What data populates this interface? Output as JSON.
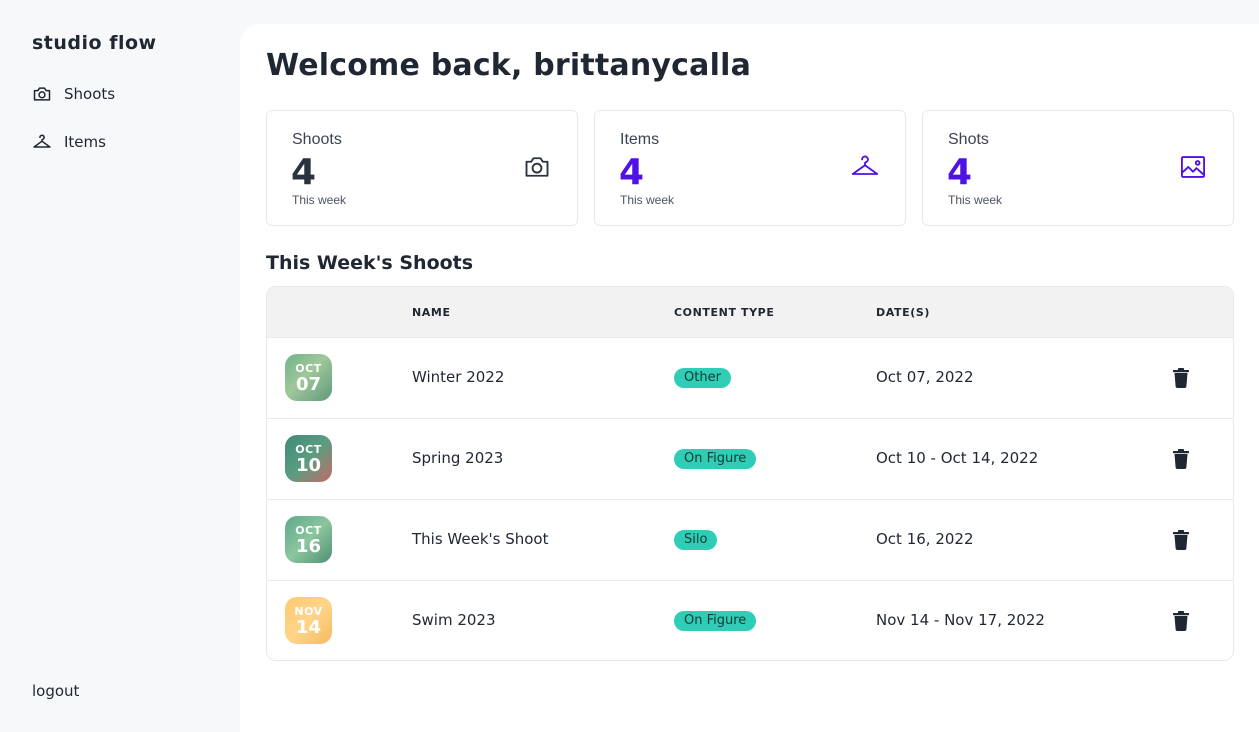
{
  "sidebar": {
    "brand": "studio flow",
    "nav": [
      {
        "label": "Shoots",
        "icon": "camera-icon"
      },
      {
        "label": "Items",
        "icon": "hanger-icon"
      }
    ],
    "logout_label": "logout"
  },
  "main": {
    "welcome": "Welcome back, brittanycalla",
    "stats": [
      {
        "label": "Shoots",
        "value": "4",
        "sub": "This week",
        "icon": "camera-icon",
        "color": "#2a323f"
      },
      {
        "label": "Items",
        "value": "4",
        "sub": "This week",
        "icon": "hanger-icon",
        "color": "#4e12e6"
      },
      {
        "label": "Shots",
        "value": "4",
        "sub": "This week",
        "icon": "image-icon",
        "color": "#4e12e6"
      }
    ],
    "section_title": "This Week's Shoots",
    "table": {
      "columns": [
        "NAME",
        "CONTENT TYPE",
        "DATE(S)"
      ],
      "rows": [
        {
          "month": "OCT",
          "day": "07",
          "name": "Winter 2022",
          "type": "Other",
          "dates": "Oct 07, 2022"
        },
        {
          "month": "OCT",
          "day": "10",
          "name": "Spring 2023",
          "type": "On Figure",
          "dates": "Oct 10 - Oct 14, 2022"
        },
        {
          "month": "OCT",
          "day": "16",
          "name": "This Week's Shoot",
          "type": "Silo",
          "dates": "Oct 16, 2022"
        },
        {
          "month": "NOV",
          "day": "14",
          "name": "Swim 2023",
          "type": "On Figure",
          "dates": "Nov 14 - Nov 17, 2022"
        }
      ]
    }
  },
  "colors": {
    "accent": "#4e12e6",
    "pill": "#2fcdb5",
    "page_bg": "#f7f8fa",
    "panel_bg": "#ffffff"
  }
}
